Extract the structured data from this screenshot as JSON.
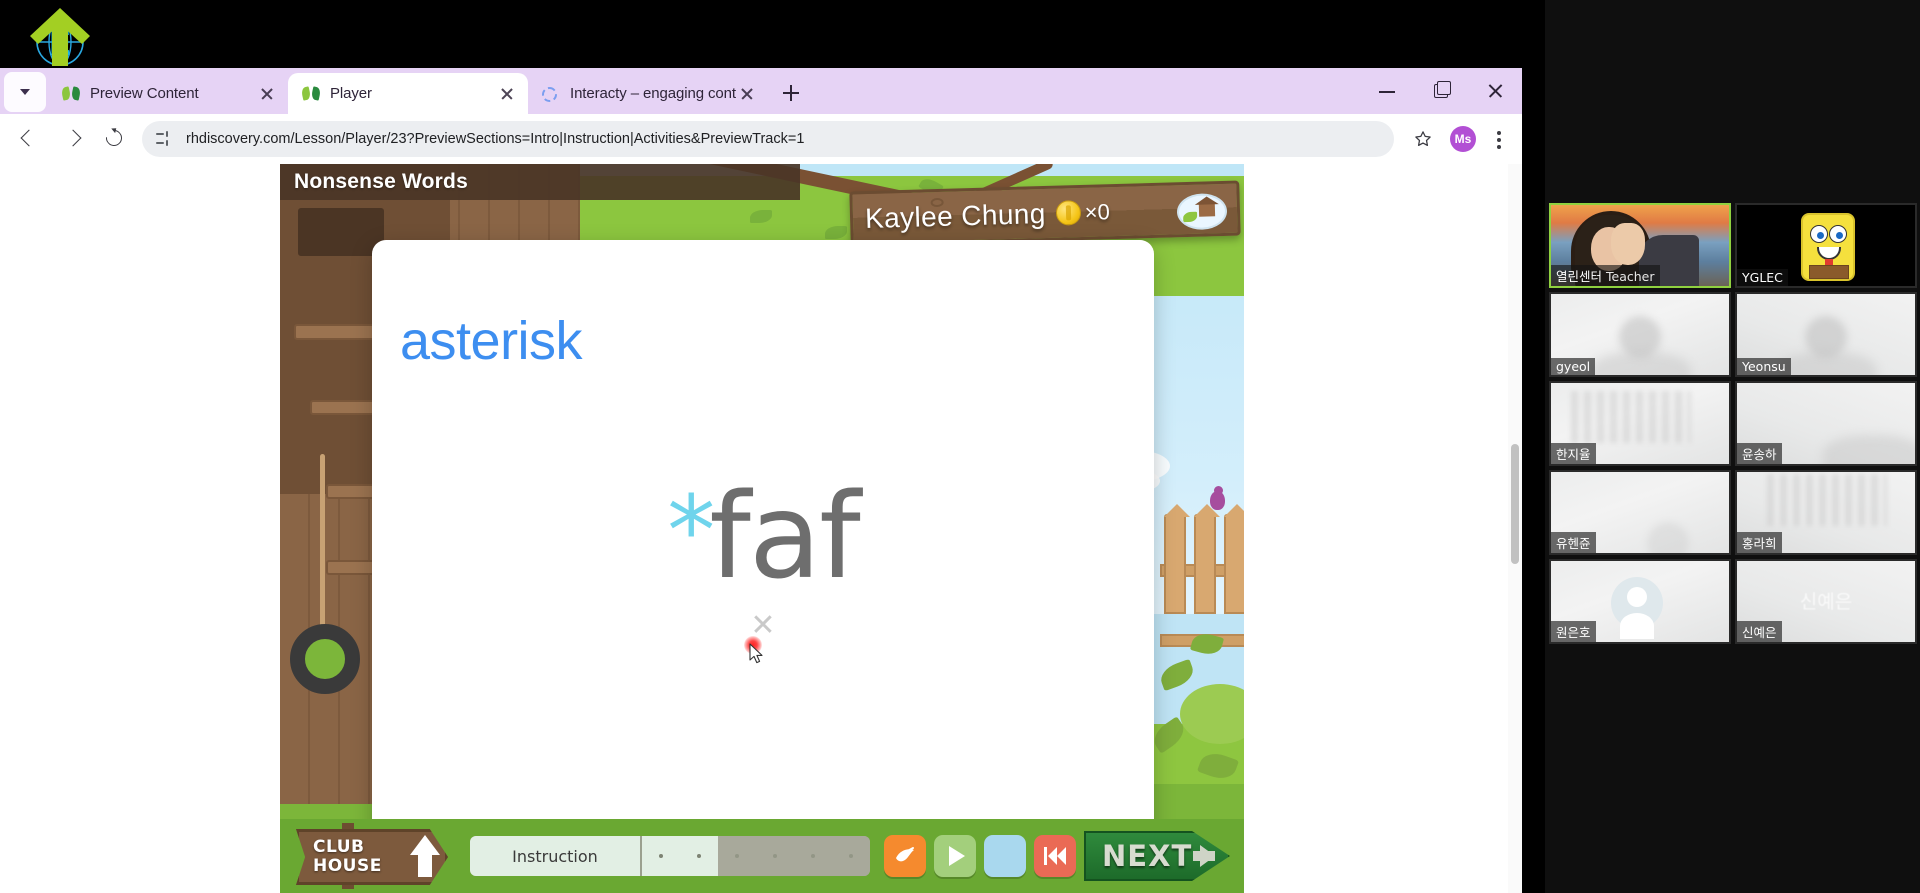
{
  "browser": {
    "tabs": [
      {
        "title": "Preview Content",
        "favicon": "butterfly-icon",
        "active": false
      },
      {
        "title": "Player",
        "favicon": "butterfly-icon",
        "active": true
      },
      {
        "title": "Interacty – engaging content |",
        "favicon": "circle-dotted-icon",
        "active": false
      }
    ],
    "url": "rhdiscovery.com/Lesson/Player/23?PreviewSections=Intro|Instruction|Activities&PreviewTrack=1",
    "profile_initials": "Ms",
    "window_controls": {
      "minimize": "–",
      "maximize": "❐",
      "close": "✕"
    }
  },
  "game": {
    "header_title": "Nonsense Words",
    "player_sign": {
      "name": "Kaylee Chung",
      "coin_count": "×0"
    },
    "card": {
      "heading": "asterisk",
      "word_symbol": "*",
      "word_text": "faf",
      "close_mark": "✕"
    },
    "bottom_bar": {
      "clubhouse_line1": "CLUB",
      "clubhouse_line2": "HOUSE",
      "progress_label": "Instruction",
      "progress_segments": [
        {
          "state": "done",
          "dot": true
        },
        {
          "state": "done",
          "dot": true
        },
        {
          "state": "todo",
          "dot": true
        },
        {
          "state": "todo",
          "dot": true
        },
        {
          "state": "todo",
          "dot": true
        },
        {
          "state": "todo",
          "dot": true
        }
      ],
      "controls": [
        {
          "name": "shuffle-button",
          "color": "#f58a2e"
        },
        {
          "name": "play-button",
          "color": "#a3cf7c"
        },
        {
          "name": "blank-button",
          "color": "#a9d8ee"
        },
        {
          "name": "rewind-button",
          "color": "#ea6a55"
        }
      ],
      "next_label": "NEXT"
    }
  },
  "video_panel": {
    "participants": [
      {
        "name": "열린센터",
        "role": "Teacher",
        "active": true,
        "kind": "teacher"
      },
      {
        "name": "YGLEC",
        "role": "",
        "active": false,
        "kind": "spongebob"
      },
      {
        "name": "gyeol",
        "role": "",
        "active": false,
        "kind": "webcam1"
      },
      {
        "name": "Yeonsu",
        "role": "",
        "active": false,
        "kind": "webcam2"
      },
      {
        "name": "한지율",
        "role": "",
        "active": false,
        "kind": "shelf"
      },
      {
        "name": "윤송하",
        "role": "",
        "active": false,
        "kind": "webcam2"
      },
      {
        "name": "유헨쥰",
        "role": "",
        "active": false,
        "kind": "webcam1"
      },
      {
        "name": "홍라희",
        "role": "",
        "active": false,
        "kind": "shelf"
      },
      {
        "name": "원은호",
        "role": "",
        "active": false,
        "kind": "avatar"
      },
      {
        "name": "신예은",
        "role": "",
        "active": false,
        "kind": "ghost",
        "ghost_text": "신예은"
      }
    ]
  },
  "colors": {
    "accent_blue": "#3d8ef0",
    "word_gray": "#6e6e6e",
    "asterisk_cyan": "#6fd4ec",
    "tab_strip": "#e6d3f5",
    "grass": "#6aa832",
    "active_border": "#8fd13f",
    "profile": "#b24fd4"
  }
}
